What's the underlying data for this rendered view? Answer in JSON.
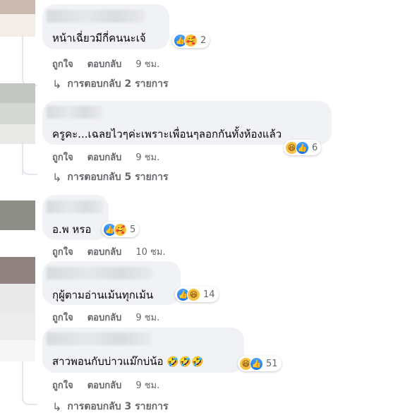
{
  "comments": [
    {
      "text": "หน้าเฉี่ยวมีกี่คนนะเจ้",
      "reaction_count": "2",
      "reactions": [
        "like-icon",
        "care-icon"
      ],
      "like_label": "ถูกใจ",
      "reply_label": "ตอบกลับ",
      "time": "9 ชม.",
      "view_replies": "การตอบกลับ 2 รายการ"
    },
    {
      "text": "ครูคะ...เฉลยไวๆค่ะเพราะเพื่อนๆลอกกันทั้งห้องแล้ว",
      "reaction_count": "6",
      "reactions": [
        "haha-icon",
        "like-icon"
      ],
      "like_label": "ถูกใจ",
      "reply_label": "ตอบกลับ",
      "time": "9 ชม.",
      "view_replies": "การตอบกลับ 5 รายการ"
    },
    {
      "text": "อ.พ หรอ",
      "reaction_count": "5",
      "reactions": [
        "like-icon",
        "care-icon"
      ],
      "like_label": "ถูกใจ",
      "reply_label": "ตอบกลับ",
      "time": "10 ชม."
    },
    {
      "text": "กุผู้ตามอ่านเม้นทุกเม้น",
      "reaction_count": "14",
      "reactions": [
        "like-icon",
        "haha-icon"
      ],
      "like_label": "ถูกใจ",
      "reply_label": "ตอบกลับ",
      "time": "9 ชม."
    },
    {
      "text": "สาวพอนกับบ่าวแม๊กบ่น้อ",
      "text_emoji": "🤣🤣🤣",
      "reaction_count": "51",
      "reactions": [
        "haha-icon",
        "like-icon"
      ],
      "like_label": "ถูกใจ",
      "reply_label": "ตอบกลับ",
      "time": "9 ชม.",
      "view_replies": "การตอบกลับ 3 รายการ"
    }
  ],
  "colors": {
    "bubble": "#f0f2f5",
    "secondary_text": "#65676b",
    "like_blue": "#1877f2",
    "emoji_yellow": "#f7c244"
  },
  "icons": {
    "reply_arrow": "reply-arrow-icon"
  }
}
